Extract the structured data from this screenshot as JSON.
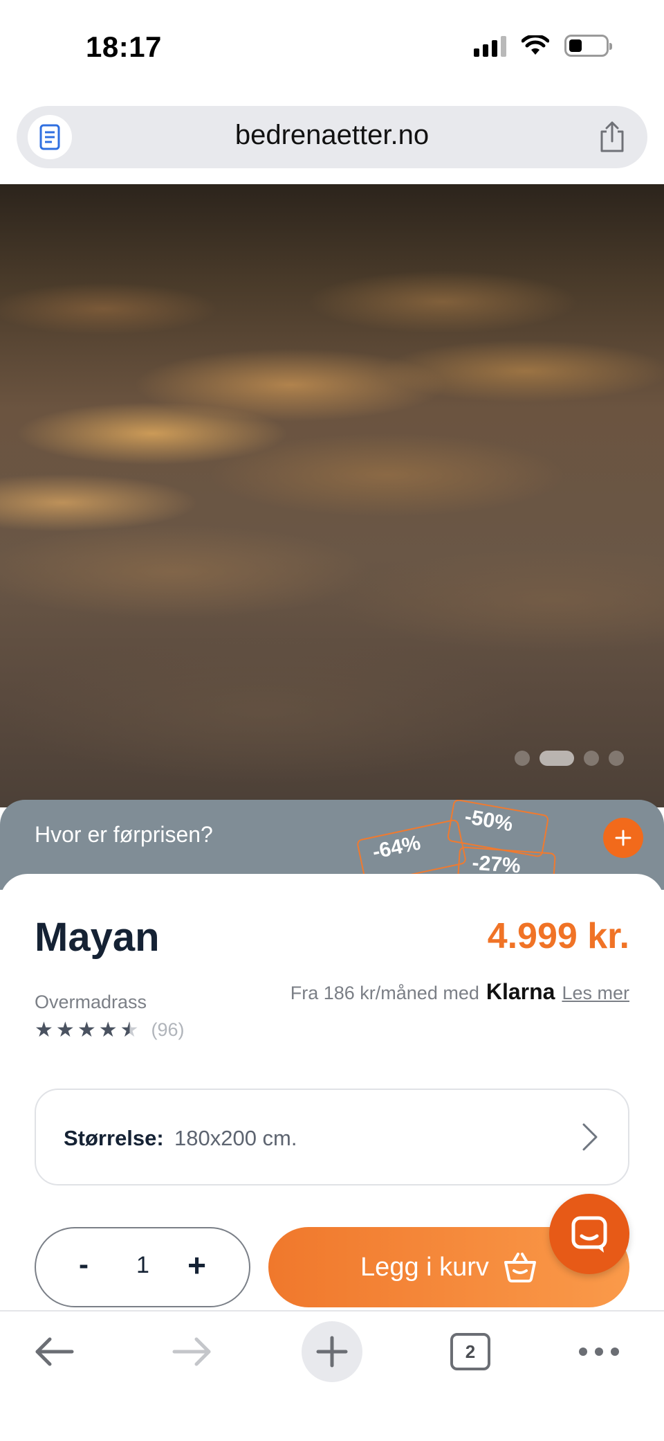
{
  "status_bar": {
    "time": "18:17"
  },
  "browser": {
    "url": "bedrenaetter.no",
    "tab_count": "2"
  },
  "hero": {
    "image_count": 4,
    "active_index": 1
  },
  "price_banner": {
    "text": "Hvor er førprisen?",
    "tags": [
      "-64%",
      "-50%",
      "-27%"
    ]
  },
  "product": {
    "name": "Mayan",
    "price": "4.999 kr.",
    "type": "Overmadrass",
    "rating_value": 4.5,
    "rating_count": "(96)",
    "klarna_text": "Fra 186 kr/måned med",
    "klarna_brand": "Klarna",
    "klarna_link": "Les mer"
  },
  "size_selector": {
    "label": "Størrelse:",
    "value": "180x200 cm."
  },
  "quantity": {
    "minus": "-",
    "value": "1",
    "plus": "+"
  },
  "cart_button": {
    "label": "Legg i kurv"
  },
  "colors": {
    "accent": "#f07326",
    "banner": "#808d96",
    "text": "#152234"
  }
}
